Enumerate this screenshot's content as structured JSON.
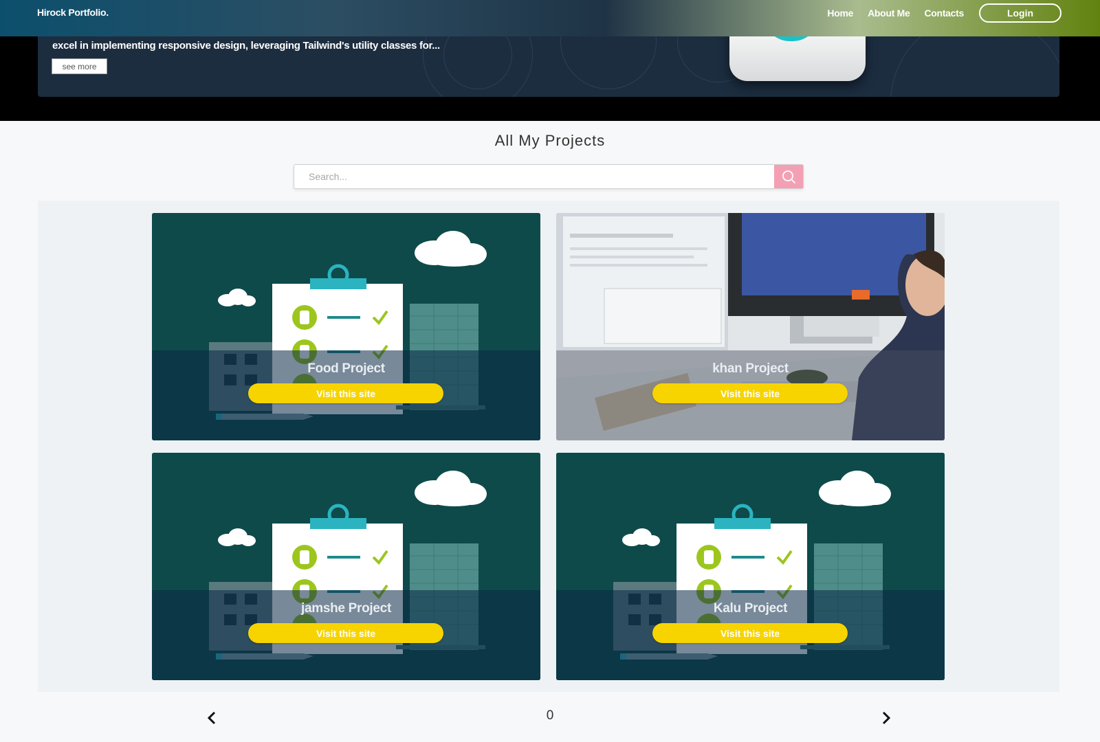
{
  "nav": {
    "brand": "Hirock Portfolio.",
    "links": [
      "Home",
      "About Me",
      "Contacts"
    ],
    "login": "Login"
  },
  "hero": {
    "text": "excel in implementing responsive design, leveraging Tailwind's utility classes for...",
    "see_more": "see more"
  },
  "projects": {
    "title": "All My Projects",
    "search_placeholder": "Search...",
    "cards": [
      {
        "title": "Food Project",
        "button": "Visit this site",
        "image": "checklist-illustration"
      },
      {
        "title": "khan Project",
        "button": "Visit this site",
        "image": "desk-computer-photo"
      },
      {
        "title": "jamshe Project",
        "button": "Visit this site",
        "image": "checklist-illustration"
      },
      {
        "title": "Kalu Project",
        "button": "Visit this site",
        "image": "checklist-illustration"
      }
    ]
  },
  "pagination": {
    "page": "0"
  },
  "colors": {
    "accent_yellow": "#f7d400",
    "card_teal": "#0e4a4a",
    "search_pink": "#f4a0b4"
  }
}
